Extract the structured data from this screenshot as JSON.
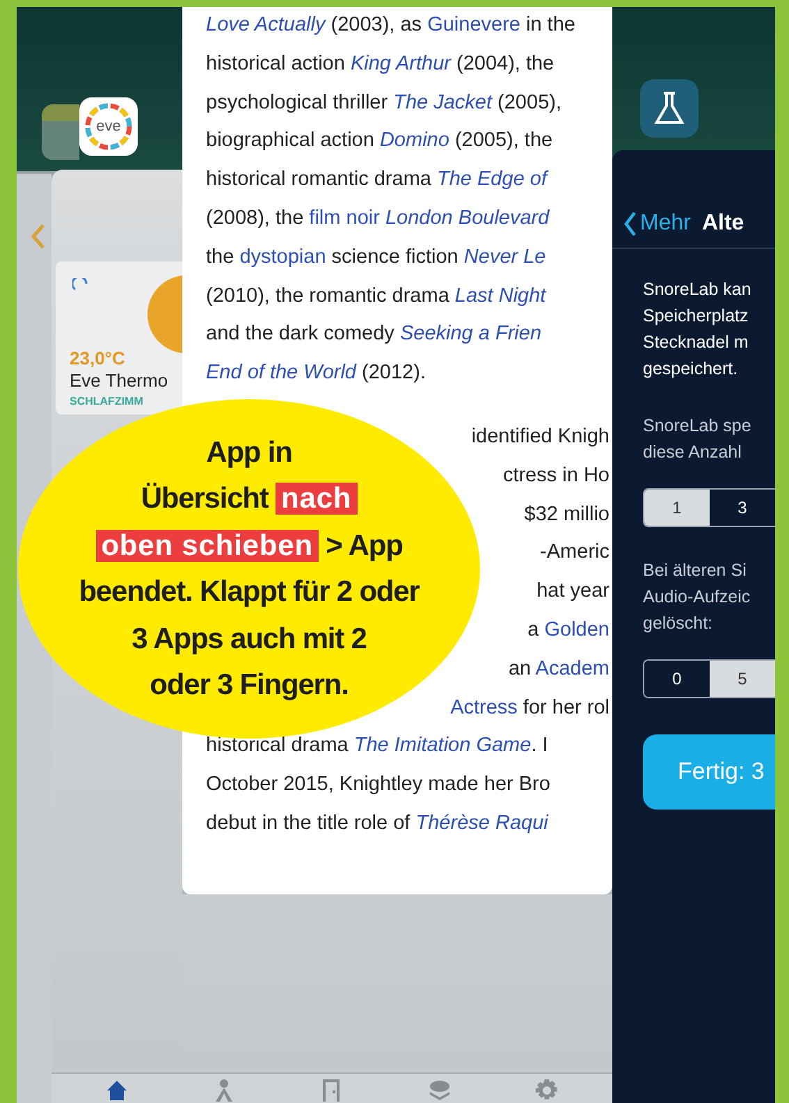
{
  "home_screen": {
    "eve_icon_text": "eve"
  },
  "eve_app": {
    "tile": {
      "temperature": "23,0°C",
      "name": "Eve Thermo",
      "room": "SCHLAFZIMM"
    },
    "tabs": [
      {
        "kind": "home",
        "selected": true
      },
      {
        "kind": "person",
        "selected": false
      },
      {
        "kind": "door",
        "selected": false
      },
      {
        "kind": "layers",
        "selected": false
      },
      {
        "kind": "gear",
        "selected": false
      }
    ]
  },
  "wiki_app": {
    "paragraphs": [
      {
        "lines": [
          {
            "kind": "full",
            "segments": [
              {
                "kind": "title",
                "text": "Love Actually"
              },
              {
                "kind": "plain",
                "text": " (2003), as "
              },
              {
                "kind": "link",
                "text": "Guinevere"
              },
              {
                "kind": "plain",
                "text": " in the"
              }
            ]
          },
          {
            "kind": "full",
            "segments": [
              {
                "kind": "plain",
                "text": "historical action "
              },
              {
                "kind": "title",
                "text": "King Arthur"
              },
              {
                "kind": "plain",
                "text": " (2004), the"
              }
            ]
          },
          {
            "kind": "full",
            "segments": [
              {
                "kind": "plain",
                "text": "psychological thriller "
              },
              {
                "kind": "title",
                "text": "The Jacket"
              },
              {
                "kind": "plain",
                "text": " (2005),"
              }
            ]
          },
          {
            "kind": "full",
            "segments": [
              {
                "kind": "plain",
                "text": "biographical action "
              },
              {
                "kind": "title",
                "text": "Domino"
              },
              {
                "kind": "plain",
                "text": " (2005), the"
              }
            ]
          },
          {
            "kind": "full",
            "segments": [
              {
                "kind": "plain",
                "text": "historical romantic drama "
              },
              {
                "kind": "title",
                "text": "The Edge of"
              }
            ]
          },
          {
            "kind": "full",
            "segments": [
              {
                "kind": "plain",
                "text": "(2008), the "
              },
              {
                "kind": "link",
                "text": "film noir"
              },
              {
                "kind": "title",
                "text": "London Boulevard"
              }
            ]
          },
          {
            "kind": "full",
            "segments": [
              {
                "kind": "plain",
                "text": "the "
              },
              {
                "kind": "link",
                "text": "dystopian"
              },
              {
                "kind": "plain",
                "text": " science fiction "
              },
              {
                "kind": "title",
                "text": "Never Le"
              }
            ]
          },
          {
            "kind": "full",
            "segments": [
              {
                "kind": "plain",
                "text": "(2010), the romantic drama "
              },
              {
                "kind": "title",
                "text": "Last Night"
              }
            ]
          },
          {
            "kind": "full",
            "segments": [
              {
                "kind": "plain",
                "text": "and the dark comedy "
              },
              {
                "kind": "title",
                "text": "Seeking a Frien"
              }
            ]
          },
          {
            "kind": "full",
            "segments": [
              {
                "kind": "title",
                "text": "End of the World"
              },
              {
                "kind": "plain",
                "text": " (2012)."
              }
            ]
          }
        ]
      },
      {
        "lines": [
          {
            "kind": "covered",
            "segments": [
              {
                "kind": "plain",
                "text": "identified Knigh"
              }
            ]
          },
          {
            "kind": "covered",
            "segments": [
              {
                "kind": "plain",
                "text": "ctress in Ho"
              }
            ]
          },
          {
            "kind": "covered",
            "segments": [
              {
                "kind": "plain",
                "text": "$32 millio"
              }
            ]
          },
          {
            "kind": "covered",
            "segments": [
              {
                "kind": "plain",
                "text": "-Americ"
              }
            ]
          },
          {
            "kind": "covered",
            "segments": [
              {
                "kind": "plain",
                "text": "hat year"
              }
            ]
          },
          {
            "kind": "covered",
            "segments": [
              {
                "kind": "plain",
                "text": "a "
              },
              {
                "kind": "link",
                "text": "Golden"
              }
            ]
          },
          {
            "kind": "covered",
            "segments": [
              {
                "kind": "plain",
                "text": "an "
              },
              {
                "kind": "link",
                "text": "Academ"
              }
            ]
          },
          {
            "kind": "covered",
            "segments": [
              {
                "kind": "link",
                "text": "Actress"
              },
              {
                "kind": "plain",
                "text": " for her rol"
              }
            ]
          },
          {
            "kind": "full",
            "segments": [
              {
                "kind": "plain",
                "text": "historical drama "
              },
              {
                "kind": "title",
                "text": "The Imitation Game"
              },
              {
                "kind": "plain",
                "text": ". I"
              }
            ]
          },
          {
            "kind": "full",
            "segments": [
              {
                "kind": "plain",
                "text": "October 2015, Knightley made her Bro"
              }
            ]
          },
          {
            "kind": "full",
            "segments": [
              {
                "kind": "plain",
                "text": "debut in the title role of "
              },
              {
                "kind": "title",
                "text": "Thérèse Raqui"
              }
            ]
          }
        ]
      }
    ]
  },
  "snorelab_app": {
    "back_label": "Mehr",
    "title": "Alte",
    "intro": [
      "SnoreLab kan",
      "Speicherplatz",
      "Stecknadel m",
      "gespeichert."
    ],
    "count_hint": [
      "SnoreLab spe",
      "diese Anzahl"
    ],
    "count_segments": [
      {
        "label": "1",
        "selected": false
      },
      {
        "label": "3",
        "selected": true
      }
    ],
    "audio_hint": [
      "Bei älteren Si",
      "Audio-Aufzeic",
      "gelöscht:"
    ],
    "audio_segments": [
      {
        "label": "0",
        "selected": true
      },
      {
        "label": "5",
        "selected": false
      }
    ],
    "done_button": "Fertig: 3"
  },
  "callout": {
    "lines": [
      [
        {
          "text": "App in",
          "highlight": false
        }
      ],
      [
        {
          "text": "Übersicht ",
          "highlight": false
        },
        {
          "text": "nach",
          "highlight": true
        }
      ],
      [
        {
          "text": "oben schieben",
          "highlight": true
        },
        {
          "text": " > App",
          "highlight": false
        }
      ],
      [
        {
          "text": "beendet. Klappt für 2 oder",
          "highlight": false
        }
      ],
      [
        {
          "text": "3 Apps auch mit 2",
          "highlight": false
        }
      ],
      [
        {
          "text": "oder 3 Fingern.",
          "highlight": false
        }
      ]
    ]
  }
}
